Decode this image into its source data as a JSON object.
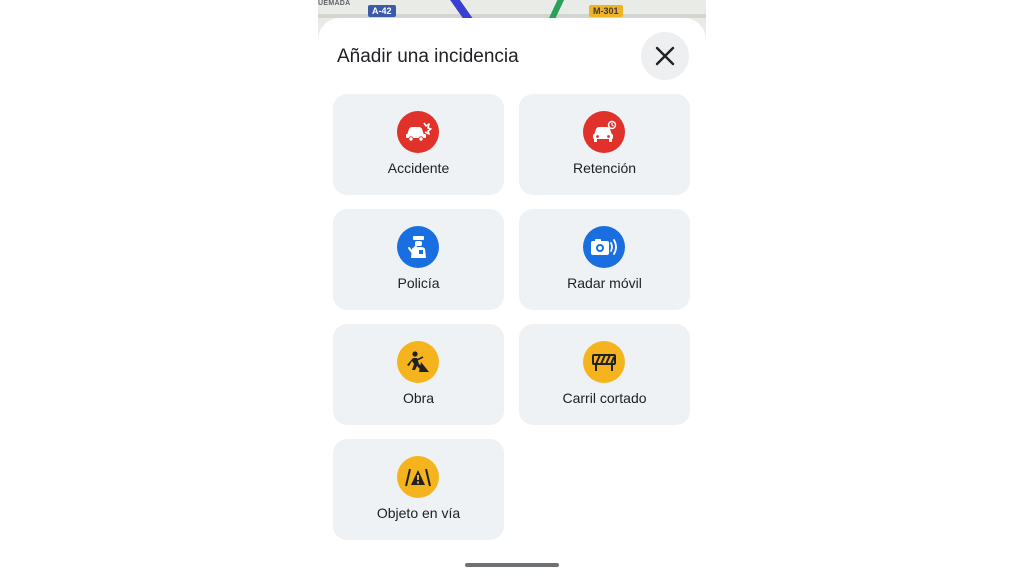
{
  "map": {
    "place_label": "UEMADA",
    "highway_shield": "A-42",
    "road_shield": "M-301"
  },
  "sheet": {
    "title": "Añadir una incidencia",
    "close_icon": "close-icon"
  },
  "incidents": [
    {
      "label": "Accidente",
      "icon": "car-crash-icon",
      "color": "#e0312b"
    },
    {
      "label": "Retención",
      "icon": "traffic-jam-icon",
      "color": "#e0312b"
    },
    {
      "label": "Policía",
      "icon": "police-icon",
      "color": "#1a6fe0"
    },
    {
      "label": "Radar móvil",
      "icon": "speed-camera-icon",
      "color": "#1a6fe0"
    },
    {
      "label": "Obra",
      "icon": "roadworks-icon",
      "color": "#f5b41e"
    },
    {
      "label": "Carril cortado",
      "icon": "lane-closed-icon",
      "color": "#f5b41e"
    },
    {
      "label": "Objeto en vía",
      "icon": "object-on-road-icon",
      "color": "#f5b41e"
    }
  ]
}
